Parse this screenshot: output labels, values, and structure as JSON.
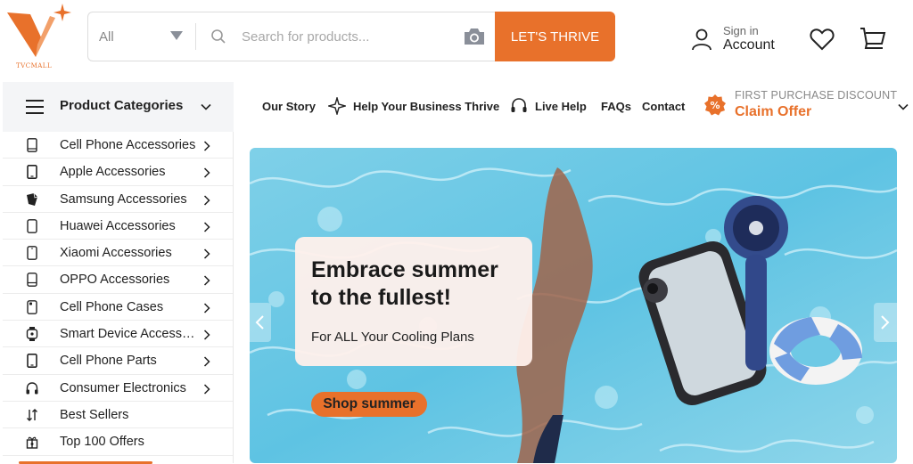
{
  "brand": {
    "name": "TVCMALL",
    "color": "#e8712b"
  },
  "search": {
    "category": "All",
    "placeholder": "Search for products...",
    "button_label": "LET'S THRIVE"
  },
  "account": {
    "small": "Sign in",
    "big": "Account"
  },
  "categories_bar": {
    "label": "Product Categories"
  },
  "nav": {
    "items": [
      {
        "label": "Our Story",
        "icon": ""
      },
      {
        "label": "Help Your Business Thrive",
        "icon": "sparkle-icon"
      },
      {
        "label": "Live Help",
        "icon": "headset-icon"
      },
      {
        "label": "FAQs",
        "icon": ""
      },
      {
        "label": "Contact",
        "icon": ""
      }
    ],
    "discount": {
      "small": "FIRST PURCHASE DISCOUNT",
      "big": "Claim Offer"
    }
  },
  "sidebar": {
    "items": [
      {
        "label": "Cell Phone Accessories",
        "icon": "phone-icon",
        "has_children": true
      },
      {
        "label": "Apple Accessories",
        "icon": "phone-icon",
        "has_children": true
      },
      {
        "label": "Samsung Accessories",
        "icon": "samsung-phone-icon",
        "has_children": true
      },
      {
        "label": "Huawei Accessories",
        "icon": "phone-icon",
        "has_children": true
      },
      {
        "label": "Xiaomi Accessories",
        "icon": "phone-icon",
        "has_children": true
      },
      {
        "label": "OPPO Accessories",
        "icon": "phone-icon",
        "has_children": true
      },
      {
        "label": "Cell Phone Cases",
        "icon": "phone-case-icon",
        "has_children": true
      },
      {
        "label": "Smart Device Accessories",
        "icon": "smartwatch-icon",
        "has_children": true
      },
      {
        "label": "Cell Phone Parts",
        "icon": "phone-icon",
        "has_children": true
      },
      {
        "label": "Consumer Electronics",
        "icon": "headphones-icon",
        "has_children": true
      },
      {
        "label": "Best Sellers",
        "icon": "sort-icon",
        "has_children": false
      },
      {
        "label": "Top 100 Offers",
        "icon": "gift-icon",
        "has_children": false
      }
    ]
  },
  "banner": {
    "title": "Embrace summer to the fullest!",
    "subtitle": "For ALL Your Cooling Plans",
    "button": "Shop summer"
  }
}
